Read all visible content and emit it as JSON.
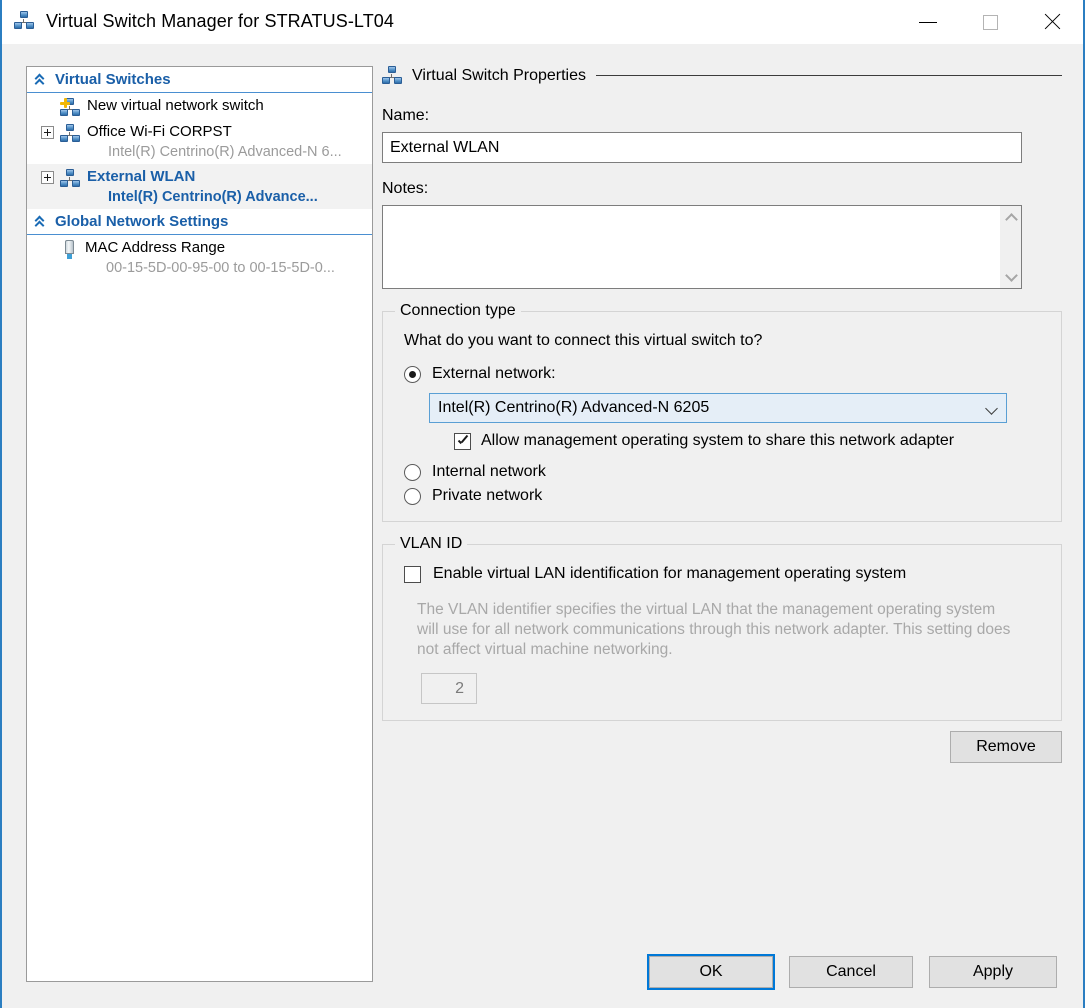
{
  "window": {
    "title": "Virtual Switch Manager for STRATUS-LT04",
    "icon": "virtual-switch-icon",
    "controls": {
      "minimize": "minimize-icon",
      "maximize": "maximize-icon",
      "close": "close-icon"
    }
  },
  "tree": {
    "groups": [
      {
        "label": "Virtual Switches",
        "collapse_icon": "chevron-up-icon",
        "items": [
          {
            "label": "New virtual network switch",
            "sub": "",
            "icon": "new-virtual-switch-icon",
            "expander": false,
            "selected": false
          },
          {
            "label": "Office Wi-Fi CORPST",
            "sub": "Intel(R) Centrino(R) Advanced-N 6...",
            "icon": "virtual-switch-icon",
            "expander": true,
            "selected": false
          },
          {
            "label": "External WLAN",
            "sub": "Intel(R) Centrino(R) Advance...",
            "icon": "virtual-switch-icon",
            "expander": true,
            "selected": true
          }
        ]
      },
      {
        "label": "Global Network Settings",
        "collapse_icon": "chevron-up-icon",
        "items": [
          {
            "label": "MAC Address Range",
            "sub": "00-15-5D-00-95-00 to 00-15-5D-0...",
            "icon": "mac-address-icon",
            "expander": false,
            "selected": false
          }
        ]
      }
    ]
  },
  "properties": {
    "header": "Virtual Switch Properties",
    "header_icon": "virtual-switch-icon",
    "name_label": "Name:",
    "name_value": "External WLAN",
    "notes_label": "Notes:",
    "notes_value": "",
    "notes_scroll_up": "scroll-up-icon",
    "notes_scroll_down": "scroll-down-icon"
  },
  "connection_type": {
    "title": "Connection type",
    "question": "What do you want to connect this virtual switch to?",
    "options": [
      {
        "label": "External network:",
        "selected": true
      },
      {
        "label": "Internal network",
        "selected": false
      },
      {
        "label": "Private network",
        "selected": false
      }
    ],
    "adapter_value": "Intel(R) Centrino(R) Advanced-N 6205",
    "adapter_arrow": "chevron-down-icon",
    "share_checkbox": {
      "label": "Allow management operating system to share this network adapter",
      "checked": true
    }
  },
  "vlan": {
    "title": "VLAN ID",
    "enable_checkbox": {
      "label": "Enable virtual LAN identification for management operating system",
      "checked": false
    },
    "description": "The VLAN identifier specifies the virtual LAN that the management operating system will use for all network communications through this network adapter. This setting does not affect virtual machine networking.",
    "id_value": "2"
  },
  "buttons": {
    "remove": "Remove",
    "ok": "OK",
    "cancel": "Cancel",
    "apply": "Apply"
  },
  "colors": {
    "accent_blue": "#1a5fa8",
    "focus_blue": "#0078d7",
    "window_border": "#2b7ec1",
    "dialog_bg": "#f0f0f0",
    "disabled_text": "#a8a8a8"
  }
}
